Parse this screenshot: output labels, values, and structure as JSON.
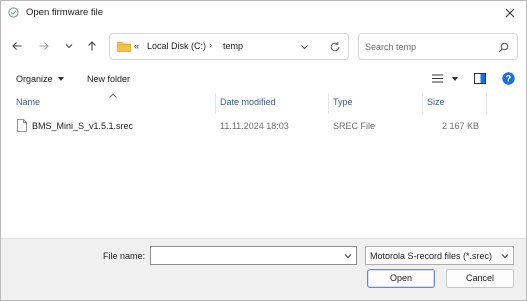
{
  "window": {
    "title": "Open firmware file",
    "icons": {
      "app": "firmware-app-icon",
      "close": "close-icon"
    }
  },
  "nav": {
    "icons": [
      "back-arrow-icon",
      "forward-arrow-icon",
      "recent-chevron-icon",
      "up-arrow-icon"
    ],
    "address": {
      "overflow_chevron": "«",
      "segments": [
        "Local Disk (C:)",
        "temp"
      ],
      "separator": "›",
      "folder_icon": "folder-icon",
      "folder_color": "#e8b52b"
    },
    "search": {
      "placeholder": "Search temp",
      "value": ""
    }
  },
  "toolbar": {
    "organize_label": "Organize",
    "new_folder_label": "New folder",
    "help_color": "#1f6fd1"
  },
  "columns": [
    "Name",
    "Date modified",
    "Type",
    "Size"
  ],
  "files": [
    {
      "name": "BMS_Mini_S_v1.5.1.srec",
      "date": "11.11.2024 18:03",
      "type": "SREC File",
      "size": "2 167 KB"
    }
  ],
  "footer": {
    "file_name_label": "File name:",
    "file_name_value": "",
    "file_type": "Motorola S-record files (*.srec)",
    "open_label": "Open",
    "cancel_label": "Cancel"
  }
}
